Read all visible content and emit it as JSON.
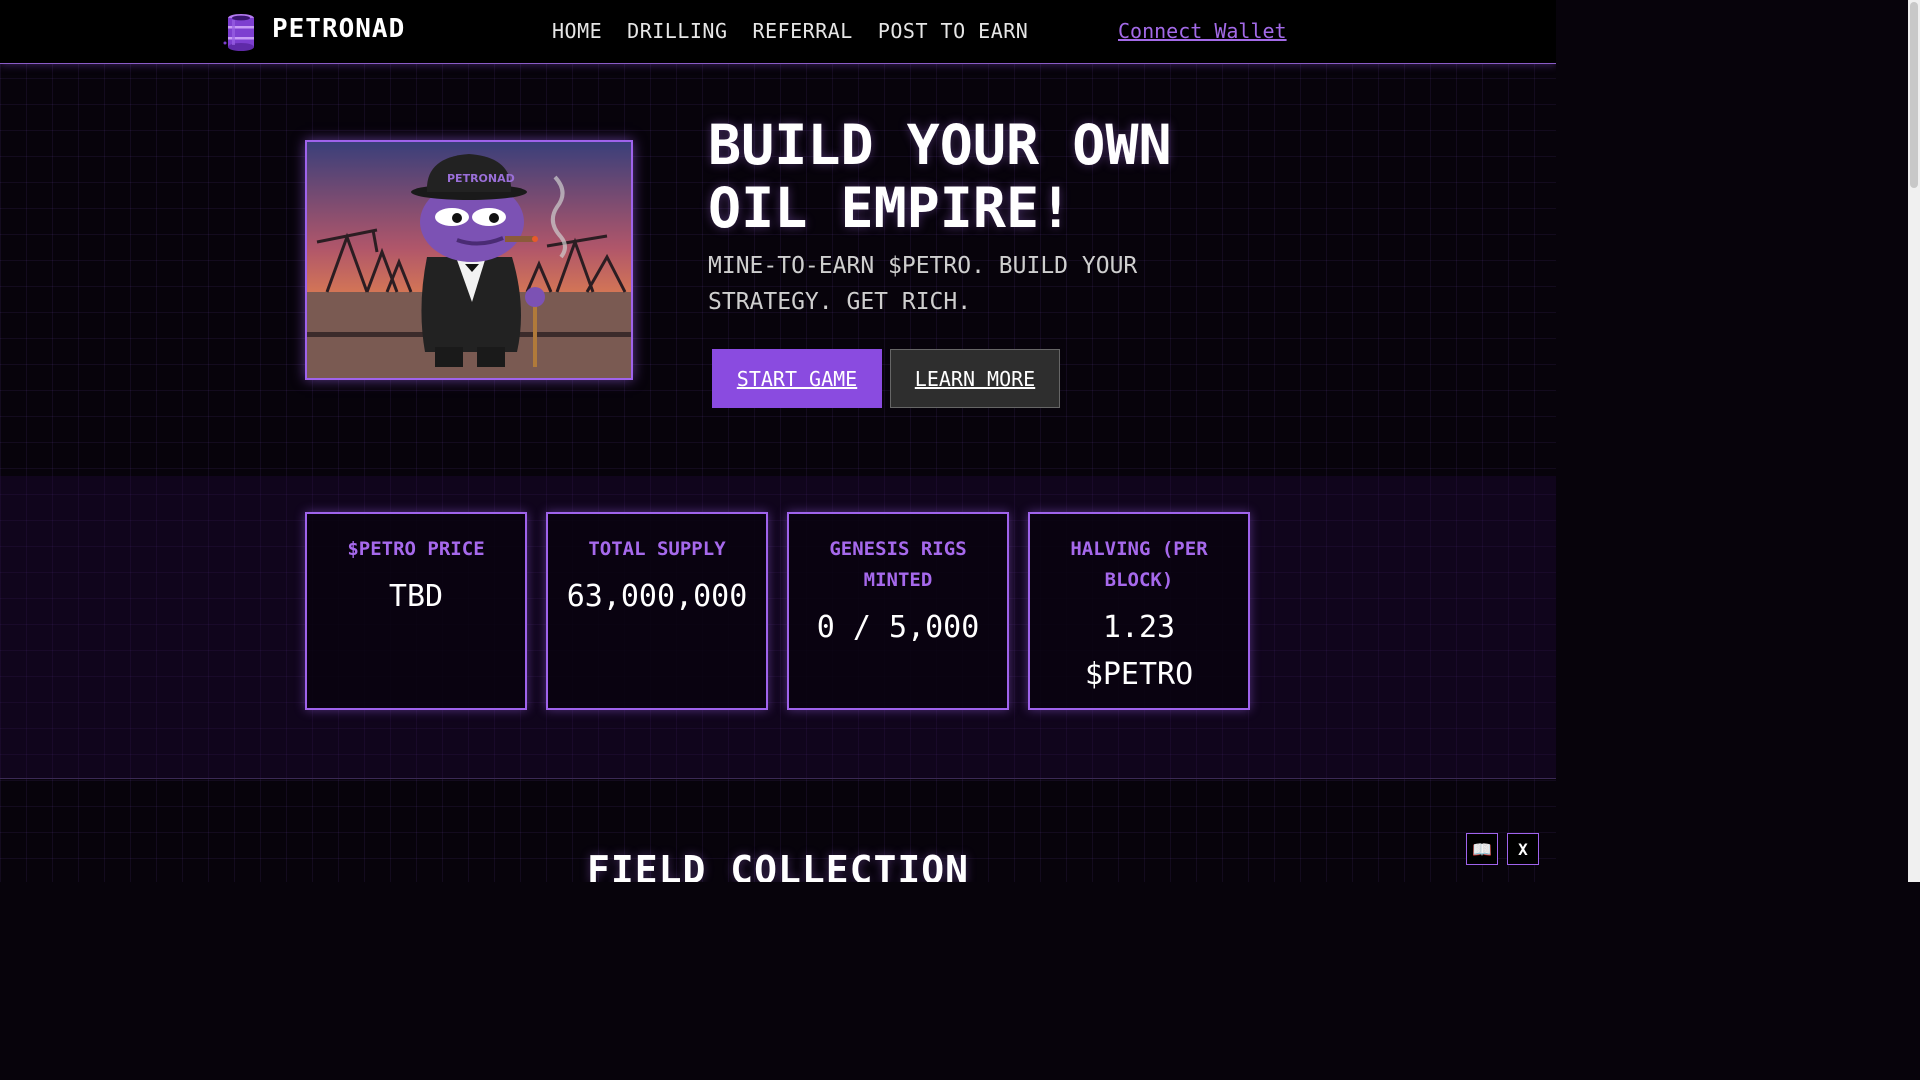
{
  "nav": {
    "logo_text": "PETRONAD",
    "links": [
      "HOME",
      "DRILLING",
      "REFERRAL",
      "POST TO EARN"
    ],
    "connect_wallet": "Connect Wallet"
  },
  "hero": {
    "title": "BUILD YOUR OWN OIL EMPIRE!",
    "subtitle": "MINE-TO-EARN $PETRO. BUILD YOUR STRATEGY. GET RICH.",
    "image_hat_text": "PETRONAD",
    "start_button": "START GAME",
    "learn_button": "LEARN MORE"
  },
  "stats": [
    {
      "label": "$PETRO PRICE",
      "value": "TBD"
    },
    {
      "label": "TOTAL SUPPLY",
      "value": "63,000,000"
    },
    {
      "label": "GENESIS RIGS MINTED",
      "value": "0 / 5,000"
    },
    {
      "label": "HALVING (PER BLOCK)",
      "value": "1.23 $PETRO"
    }
  ],
  "section": {
    "title": "FIELD COLLECTION"
  },
  "floating": {
    "docs_icon": "📖",
    "x_label": "X"
  },
  "colors": {
    "accent": "#9f63ec",
    "button_primary": "#8a4be0",
    "background": "#07030b"
  }
}
